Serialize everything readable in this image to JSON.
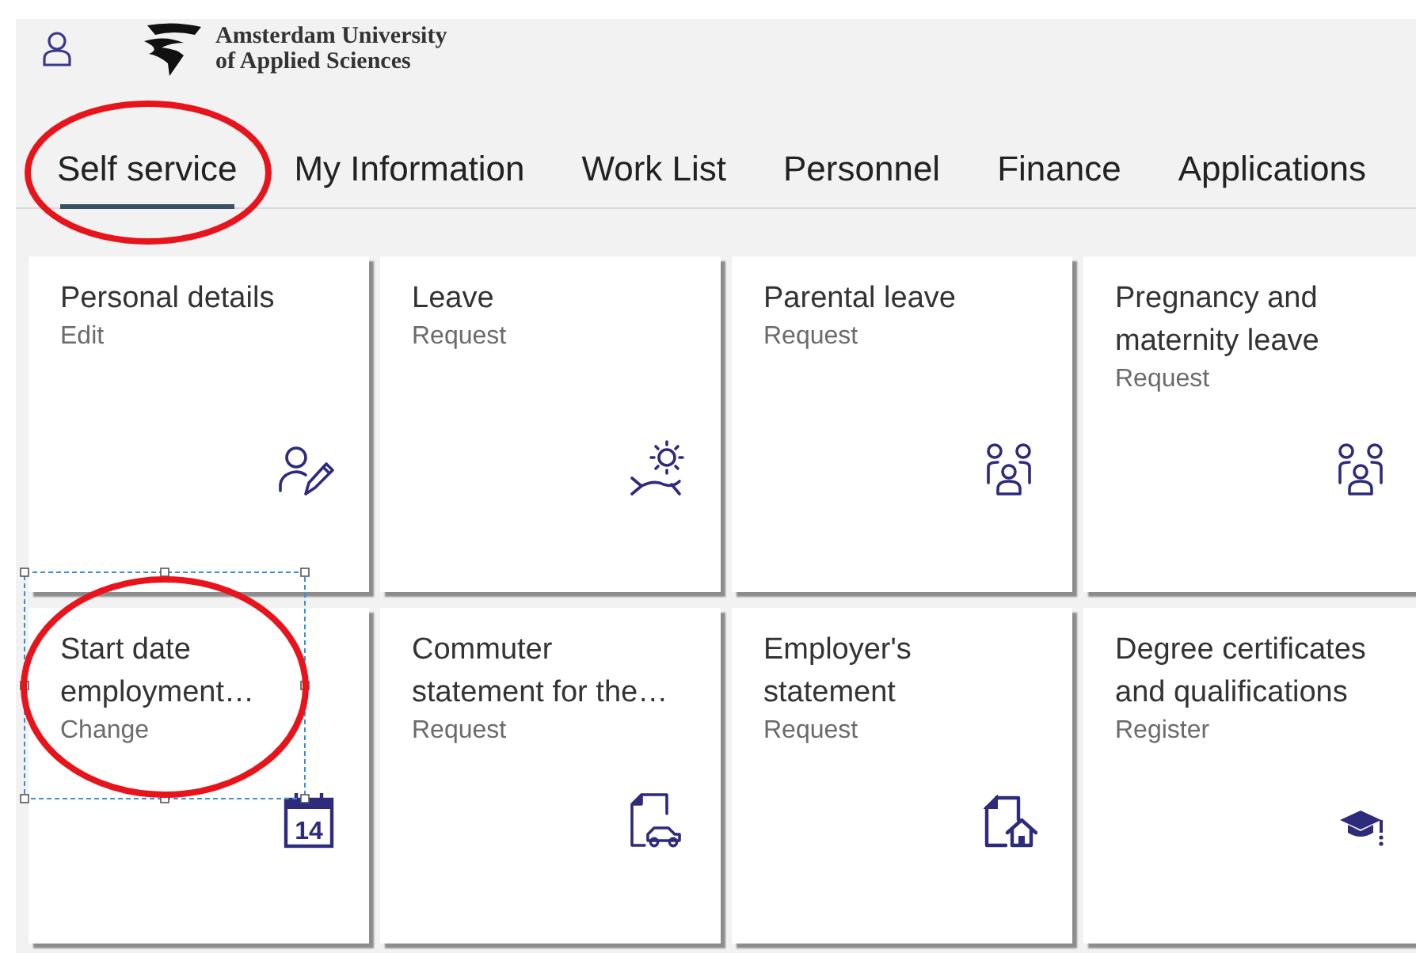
{
  "header": {
    "logo_lines": [
      "Amsterdam University",
      "of Applied Sciences"
    ]
  },
  "tabs": [
    {
      "label": "Self service",
      "selected": true,
      "circled": true
    },
    {
      "label": "My Information",
      "selected": false,
      "circled": false
    },
    {
      "label": "Work List",
      "selected": false,
      "circled": false
    },
    {
      "label": "Personnel",
      "selected": false,
      "circled": false
    },
    {
      "label": "Finance",
      "selected": false,
      "circled": false
    },
    {
      "label": "Applications",
      "selected": false,
      "circled": false
    }
  ],
  "tiles": [
    {
      "title": "Personal details",
      "action": "Edit",
      "kind": "edit",
      "circled": false,
      "framed": false
    },
    {
      "title": "Leave",
      "action": "Request",
      "kind": "leave",
      "circled": false,
      "framed": false
    },
    {
      "title": "Parental leave",
      "action": "Request",
      "kind": "family",
      "circled": false,
      "framed": false
    },
    {
      "title": "Pregnancy and maternity leave",
      "action": "Request",
      "kind": "family",
      "circled": false,
      "framed": false
    },
    {
      "title": "Start date employment…",
      "action": "Change",
      "kind": "calendar",
      "icon_text": "14",
      "circled": true,
      "framed": true
    },
    {
      "title": "Commuter statement for the…",
      "action": "Request",
      "kind": "doc-car",
      "circled": false,
      "framed": false
    },
    {
      "title": "Employer's statement",
      "action": "Request",
      "kind": "doc-house",
      "circled": false,
      "framed": false
    },
    {
      "title": "Degree certificates and qualifications",
      "action": "Register",
      "kind": "cap",
      "circled": false,
      "framed": false
    }
  ]
}
